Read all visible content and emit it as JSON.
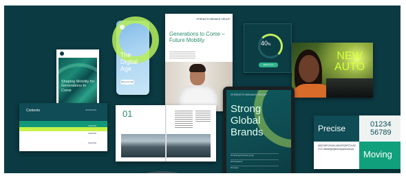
{
  "social_post": {
    "title": "Shaping Mobility for Generations to Come"
  },
  "phone": {
    "title": "The Digital Age",
    "button": "Find out more"
  },
  "report": {
    "brand": "STRENGTH BRANDS GROUP",
    "title": "Generations to Come – Future Mobility"
  },
  "widget": {
    "value": "40",
    "unit": "%",
    "button": "Read more"
  },
  "ad": {
    "headline_1": "NEW",
    "headline_2": "AUTO"
  },
  "brochure": {
    "cover_label": "Contents",
    "rows": [
      "00.00.00.00",
      "00.00.00",
      "00.00.00",
      "00.00.00"
    ]
  },
  "book": {
    "number": "01"
  },
  "tablet": {
    "brand": "STRENGTH BRANDS GROUP",
    "title": "Strong Global Brands",
    "rows": [
      "01 Strength brands group",
      "02 Foreword",
      "03 Index"
    ]
  },
  "specimen": {
    "word_1": "Precise",
    "digits_1": "01234",
    "digits_2": "56789",
    "word_2": "Moving",
    "sample": "ABCDEFGHIJKLMNOPQRSTUVWXYZ abcdefghijklmnopqrstuvwxyz"
  },
  "colors": {
    "background": "#0b3a42",
    "accent": "#c4f05a",
    "brand_teal": "#11a07c"
  }
}
